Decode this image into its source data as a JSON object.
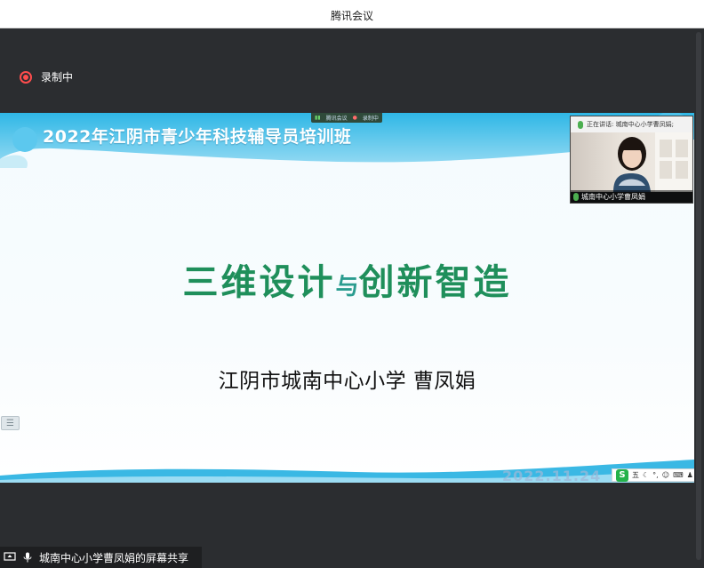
{
  "window": {
    "title": "腾讯会议"
  },
  "recording": {
    "label": "录制中",
    "color": "#ff4d4d"
  },
  "slide": {
    "banner_title": "2022年江阴市青少年科技辅导员培训班",
    "mini_badge": {
      "item1": "腾讯会议",
      "item2": "录制中"
    },
    "main_title_part1": "三维设计",
    "main_title_joiner": "与",
    "main_title_part2": "创新智造",
    "subtitle": "江阴市城南中心小学   曹凤娟",
    "side_handle_icon": "list-icon",
    "date_watermark": "2022.11.24",
    "ime_bar": {
      "logo": "S",
      "label": "五",
      "icons": [
        "moon-icon",
        "punctuation-icon",
        "emoji-icon",
        "keyboard-icon",
        "shirt-icon",
        "grid-icon"
      ]
    },
    "accent_color": "#1f8f5b"
  },
  "video_tile": {
    "speaking_label": "正在讲话: 城南中心小学曹凤娟;",
    "participant_name": "城南中心小学曹凤娟"
  },
  "share_bar": {
    "label": "城南中心小学曹凤娟的屏幕共享"
  }
}
